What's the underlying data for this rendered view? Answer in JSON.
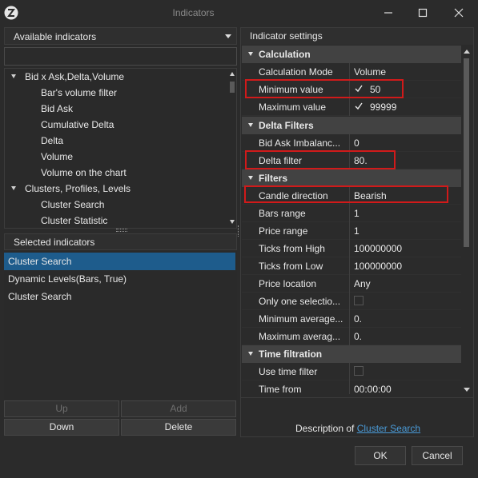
{
  "window": {
    "title": "Indicators",
    "app_icon": "atas-logo-icon",
    "controls": [
      "minimize-icon",
      "maximize-icon",
      "close-icon"
    ]
  },
  "left": {
    "dropdown_label": "Available indicators",
    "search_value": "",
    "tree": [
      {
        "label": "Bid x Ask,Delta,Volume",
        "level": 0,
        "expanded": true
      },
      {
        "label": "Bar's volume filter",
        "level": 1
      },
      {
        "label": "Bid Ask",
        "level": 1
      },
      {
        "label": "Cumulative Delta",
        "level": 1
      },
      {
        "label": "Delta",
        "level": 1
      },
      {
        "label": "Volume",
        "level": 1
      },
      {
        "label": "Volume on the chart",
        "level": 1
      },
      {
        "label": "Clusters, Profiles, Levels",
        "level": 0,
        "expanded": true
      },
      {
        "label": "Cluster Search",
        "level": 1
      },
      {
        "label": "Cluster Statistic",
        "level": 1
      }
    ],
    "selected_header": "Selected indicators",
    "selected": [
      {
        "label": "Cluster Search",
        "active": true
      },
      {
        "label": "Dynamic Levels(Bars, True)",
        "active": false
      },
      {
        "label": "Cluster Search",
        "active": false
      }
    ],
    "buttons": {
      "up": "Up",
      "add": "Add",
      "down": "Down",
      "delete": "Delete"
    }
  },
  "right": {
    "header": "Indicator settings",
    "sections": [
      {
        "category": "Calculation",
        "rows": [
          {
            "name": "Calculation Mode",
            "value": "Volume"
          },
          {
            "name": "Minimum value",
            "checked": true,
            "value": "50"
          },
          {
            "name": "Maximum value",
            "checked": true,
            "value": "99999"
          }
        ]
      },
      {
        "category": "Delta Filters",
        "rows": [
          {
            "name": "Bid Ask Imbalanc...",
            "value": "0"
          },
          {
            "name": "Delta filter",
            "value": "80."
          }
        ]
      },
      {
        "category": "Filters",
        "rows": [
          {
            "name": "Candle direction",
            "value": "Bearish"
          },
          {
            "name": "Bars range",
            "value": "1"
          },
          {
            "name": "Price range",
            "value": "1"
          },
          {
            "name": "Ticks from High",
            "value": "100000000"
          },
          {
            "name": "Ticks  from Low",
            "value": "100000000"
          },
          {
            "name": "Price location",
            "value": "Any"
          },
          {
            "name": "Only one selectio...",
            "checked": false,
            "value": ""
          },
          {
            "name": "Minimum average...",
            "value": "0."
          },
          {
            "name": "Maximum averag...",
            "value": "0."
          }
        ]
      },
      {
        "category": "Time filtration",
        "rows": [
          {
            "name": "Use time filter",
            "checked": false,
            "value": ""
          },
          {
            "name": "Time from",
            "value": "00:00:00"
          }
        ]
      }
    ],
    "description_prefix": "Description of",
    "description_link": "Cluster Search"
  },
  "footer": {
    "ok": "OK",
    "cancel": "Cancel"
  },
  "colors": {
    "selection": "#1e5c8c",
    "highlight": "#d11a1a",
    "link": "#4a9bd8"
  }
}
